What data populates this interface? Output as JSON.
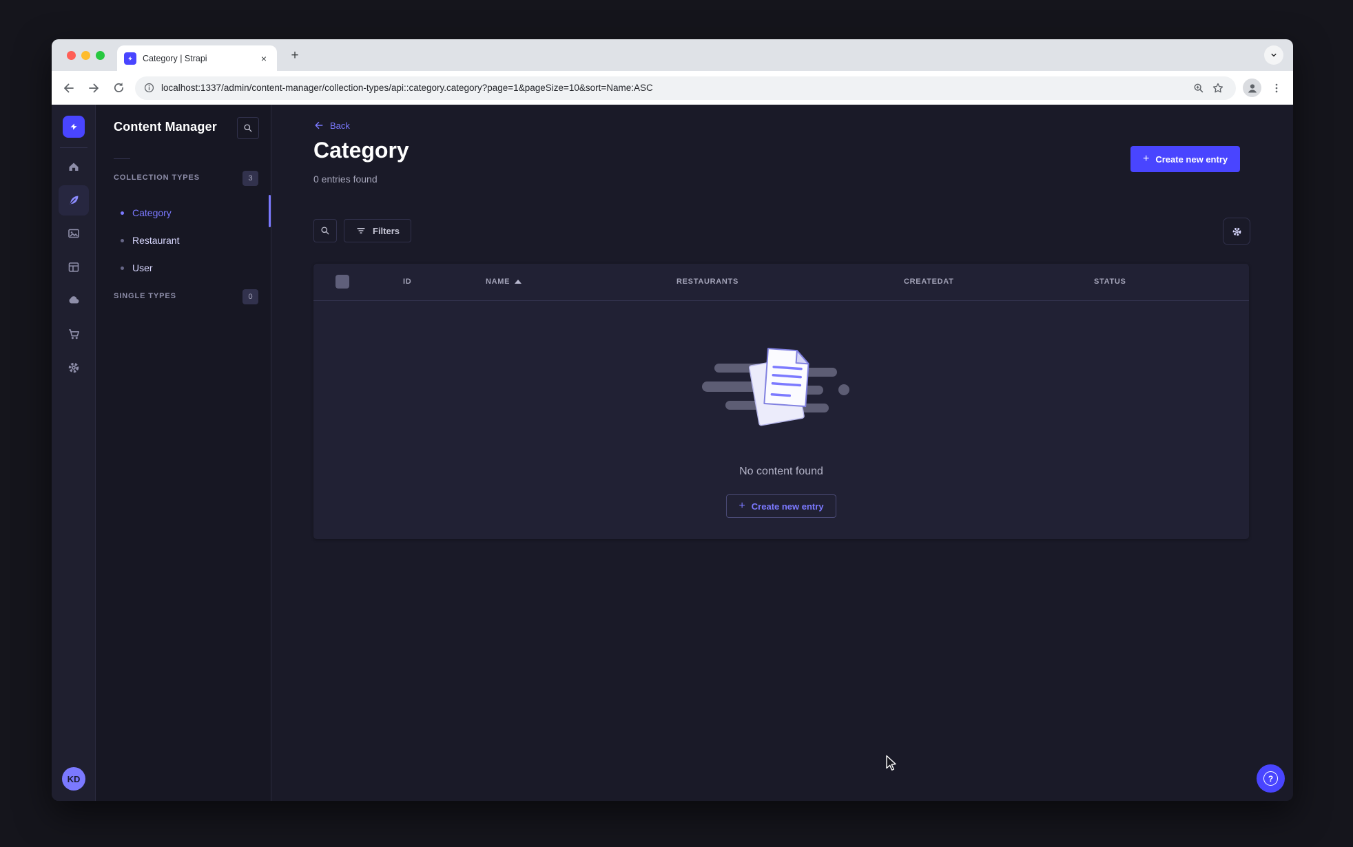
{
  "browser": {
    "tab_title": "Category | Strapi",
    "url": "localhost:1337/admin/content-manager/collection-types/api::category.category?page=1&pageSize=10&sort=Name:ASC"
  },
  "icons": {
    "plus": "+",
    "close": "×",
    "question": "?"
  },
  "sidebar": {
    "avatar_initials": "KD",
    "items": [
      {
        "name": "home"
      },
      {
        "name": "content-manager",
        "active": true
      },
      {
        "name": "media-library"
      },
      {
        "name": "content-type-builder"
      },
      {
        "name": "deploy"
      },
      {
        "name": "marketplace"
      },
      {
        "name": "settings"
      }
    ]
  },
  "panel": {
    "title": "Content Manager",
    "sections": [
      {
        "label": "COLLECTION TYPES",
        "badge": "3",
        "items": [
          {
            "label": "Category",
            "active": true
          },
          {
            "label": "Restaurant",
            "active": false
          },
          {
            "label": "User",
            "active": false
          }
        ]
      },
      {
        "label": "SINGLE TYPES",
        "badge": "0",
        "items": []
      }
    ]
  },
  "main": {
    "back_label": "Back",
    "title": "Category",
    "subtitle": "0 entries found",
    "create_button_label": "Create new entry",
    "filters_label": "Filters",
    "table": {
      "headers": [
        "ID",
        "NAME",
        "RESTAURANTS",
        "CREATEDAT",
        "STATUS"
      ],
      "sorted_by": "NAME",
      "sort_direction": "ascending"
    },
    "empty_state": {
      "message": "No content found",
      "create_button_label": "Create new entry"
    }
  },
  "colors": {
    "accent": "#4945ff",
    "accent_light": "#7b79ff",
    "surface": "#212134",
    "background": "#1a1a28",
    "traffic_red": "#ff5f57",
    "traffic_yellow": "#febc2e",
    "traffic_green": "#28c840"
  }
}
